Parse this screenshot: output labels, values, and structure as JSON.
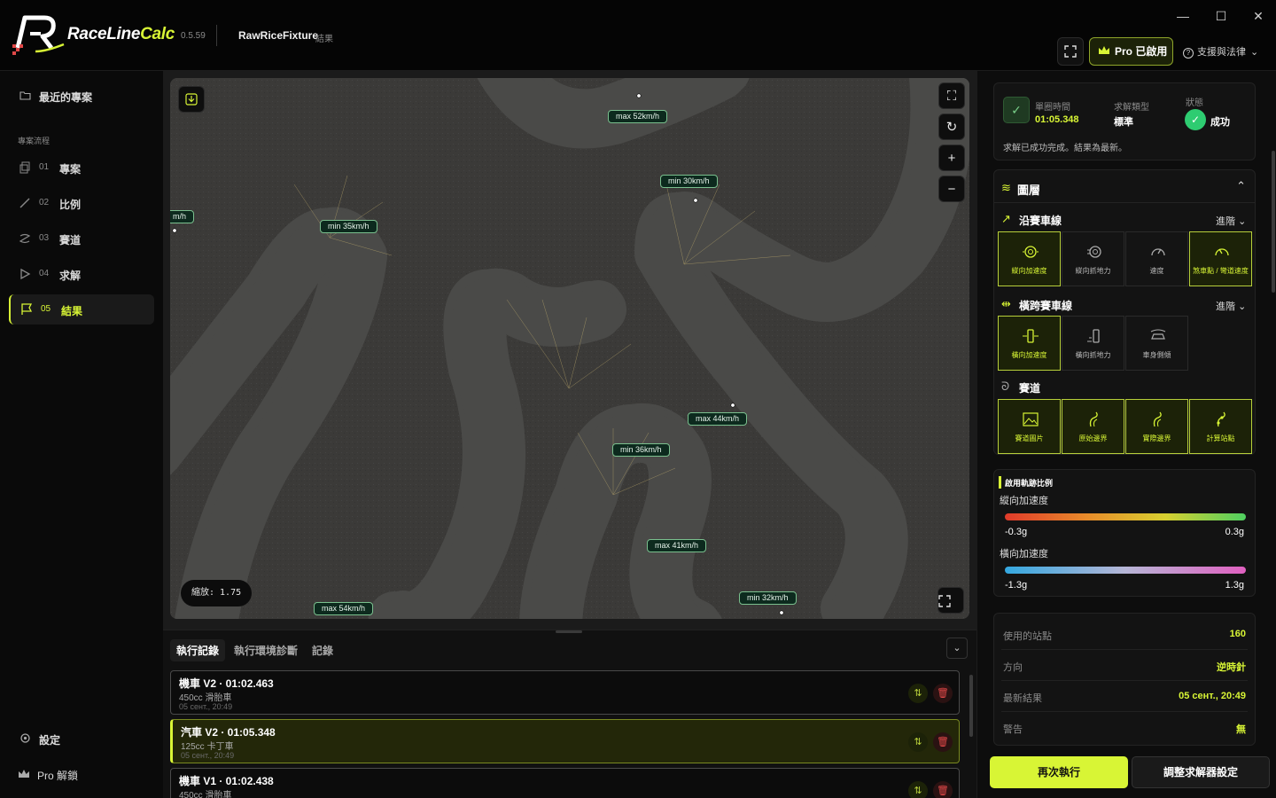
{
  "app": {
    "brand_main": "RaceLine",
    "brand_accent": "Calc",
    "version": "0.5.59",
    "project_name": "RawRiceFixture",
    "project_sub": "結果"
  },
  "titlebar": {
    "pro_label": "Pro 已啟用",
    "help_label": "支援與法律"
  },
  "sidebar": {
    "recent": "最近的專案",
    "section": "專案流程",
    "items": [
      {
        "num": "01",
        "label": "專案"
      },
      {
        "num": "02",
        "label": "比例"
      },
      {
        "num": "03",
        "label": "賽道"
      },
      {
        "num": "04",
        "label": "求解"
      },
      {
        "num": "05",
        "label": "結果"
      }
    ],
    "settings": "設定",
    "pro_unlock": "Pro 解鎖"
  },
  "map": {
    "zoom_label": "縮放: 1.75",
    "speed_tags": [
      "max 52km/h",
      "min 30km/h",
      "m/h",
      "min 35km/h",
      "max 44km/h",
      "min 36km/h",
      "max 41km/h",
      "max 54km/h",
      "min 32km/h"
    ]
  },
  "bottom": {
    "tabs": [
      "執行記錄",
      "執行環境診斷",
      "記錄"
    ],
    "runs": [
      {
        "title": "機車 V2 · 01:02.463",
        "sub": "450cc 滑胎車",
        "date": "05 сент., 20:49"
      },
      {
        "title": "汽車 V2 · 01:05.348",
        "sub": "125cc 卡丁車",
        "date": "05 сент., 20:49"
      },
      {
        "title": "機車 V1 · 01:02.438",
        "sub": "450cc 滑胎車",
        "date": ""
      }
    ]
  },
  "status_card": {
    "lap_label": "單圈時間",
    "lap_value": "01:05.348",
    "type_label": "求解類型",
    "type_value": "標準",
    "state_label": "狀態",
    "state_value": "成功",
    "message": "求解已成功完成。結果為最新。"
  },
  "layers": {
    "title": "圖層",
    "racing_line": {
      "title": "沿賽車線",
      "advanced": "進階",
      "tiles": [
        "縱向加速度",
        "縱向抓地力",
        "速度",
        "煞車點 / 彎道速度"
      ]
    },
    "cross_line": {
      "title": "橫跨賽車線",
      "advanced": "進階",
      "tiles": [
        "橫向加速度",
        "橫向抓地力",
        "車身側傾"
      ]
    },
    "track": {
      "title": "賽道",
      "tiles": [
        "賽道圖片",
        "原始邊界",
        "實際邊界",
        "計算站點"
      ]
    }
  },
  "scale": {
    "title": "啟用軌跡比例",
    "long_label": "縱向加速度",
    "long_min": "-0.3g",
    "long_max": "0.3g",
    "lat_label": "橫向加速度",
    "lat_min": "-1.3g",
    "lat_max": "1.3g"
  },
  "info": [
    {
      "label": "使用的站點",
      "value": "160"
    },
    {
      "label": "方向",
      "value": "逆時針"
    },
    {
      "label": "最新結果",
      "value": "05 сент., 20:49"
    },
    {
      "label": "警告",
      "value": "無"
    }
  ],
  "actions": {
    "rerun": "再次執行",
    "adjust": "調整求解器設定"
  },
  "colors": {
    "accent": "#d8f535",
    "success": "#2ecc71",
    "danger": "#e04848"
  }
}
